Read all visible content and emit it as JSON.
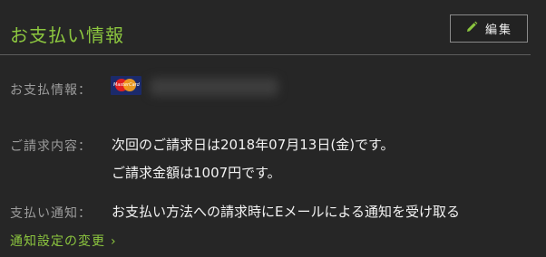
{
  "section": {
    "title": "お支払い情報",
    "edit_label": "編集"
  },
  "payment_info": {
    "label": "お支払情報：",
    "card_brand": "MasterCard"
  },
  "billing": {
    "label": "ご請求内容：",
    "line1": "次回のご請求日は2018年07月13日(金)です。",
    "line2": "ご請求金額は1007円です。"
  },
  "notification": {
    "label": "支払い通知：",
    "value": "お支払い方法への請求時にEメールによる通知を受け取る"
  },
  "link": {
    "label": "通知設定の変更",
    "chevron": "›"
  },
  "colors": {
    "background": "#262626",
    "accent": "#8cc63f",
    "label": "#9c9c9c",
    "text": "#f2f2f2"
  },
  "icons": {
    "edit": "pencil-icon",
    "card": "mastercard-icon",
    "link": "chevron-right-icon"
  }
}
